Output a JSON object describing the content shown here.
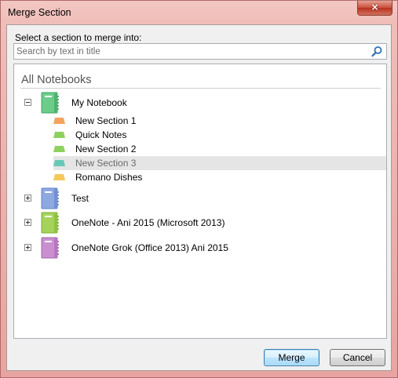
{
  "window": {
    "title": "Merge Section",
    "close_glyph": "×"
  },
  "dialog": {
    "prompt": "Select a section to merge into:",
    "search": {
      "placeholder": "Search by text in title",
      "value": ""
    },
    "root_label": "All Notebooks"
  },
  "notebooks": [
    {
      "label": "My Notebook",
      "expanded": true,
      "color": "#6ccc8a",
      "sections": [
        {
          "label": "New Section 1",
          "color": "#f4a460",
          "selected": false
        },
        {
          "label": "Quick Notes",
          "color": "#8fd15e",
          "selected": false
        },
        {
          "label": "New Section 2",
          "color": "#8fd15e",
          "selected": false
        },
        {
          "label": "New Section 3",
          "color": "#68c9b8",
          "selected": true
        },
        {
          "label": "Romano Dishes",
          "color": "#f5c85a",
          "selected": false
        }
      ]
    },
    {
      "label": "Test",
      "expanded": false,
      "color": "#8fa8e0",
      "sections": []
    },
    {
      "label": "OneNote - Ani 2015 (Microsoft 2013)",
      "expanded": false,
      "color": "#a5d35a",
      "sections": []
    },
    {
      "label": "OneNote Grok (Office 2013) Ani 2015",
      "expanded": false,
      "color": "#c98fd0",
      "sections": []
    }
  ],
  "buttons": {
    "merge": "Merge",
    "cancel": "Cancel"
  },
  "colors": {
    "title_bar": "#f0bdb8",
    "selection": "#e5e5e5",
    "default_button": "#bee6fd"
  }
}
